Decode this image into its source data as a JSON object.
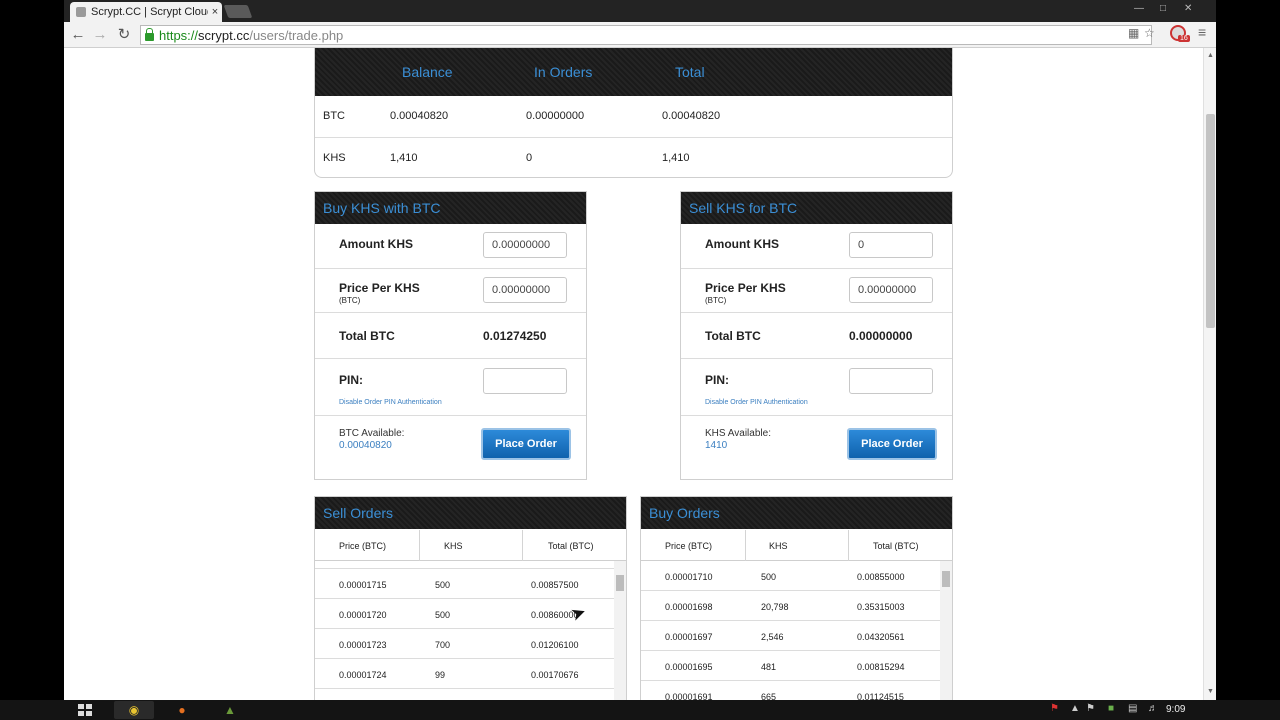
{
  "browser": {
    "tab_title": "Scrypt.CC | Scrypt Cloud M",
    "tab_close": "×",
    "url_scheme": "https://",
    "url_host": "scrypt.cc",
    "url_path": "/users/trade.php",
    "notification_count": "16"
  },
  "balances": {
    "headers": [
      "Balance",
      "In Orders",
      "Total"
    ],
    "rows": [
      {
        "currency": "BTC",
        "balance": "0.00040820",
        "in_orders": "0.00000000",
        "total": "0.00040820"
      },
      {
        "currency": "KHS",
        "balance": "1,410",
        "in_orders": "0",
        "total": "1,410"
      }
    ],
    "header_color": "#3b8fd6"
  },
  "buy_panel": {
    "title": "Buy KHS with BTC",
    "amount_label": "Amount KHS",
    "amount_placeholder": "0.00000000",
    "price_label": "Price Per KHS",
    "price_sub": "(BTC)",
    "price_placeholder": "0.00000000",
    "total_label": "Total BTC",
    "total_value": "0.01274250",
    "pin_label": "PIN:",
    "pin_link": "Disable Order PIN Authentication",
    "available_label": "BTC Available:",
    "available_value": "0.00040820",
    "button": "Place Order"
  },
  "sell_panel": {
    "title": "Sell KHS for BTC",
    "amount_label": "Amount KHS",
    "amount_value": "0",
    "price_label": "Price Per KHS",
    "price_sub": "(BTC)",
    "price_placeholder": "0.00000000",
    "total_label": "Total BTC",
    "total_value": "0.00000000",
    "pin_label": "PIN:",
    "pin_link": "Disable Order PIN Authentication",
    "available_label": "KHS Available:",
    "available_value": "1410",
    "button": "Place Order"
  },
  "sell_orders": {
    "title": "Sell Orders",
    "columns": [
      "Price (BTC)",
      "KHS",
      "Total (BTC)"
    ],
    "rows": [
      [
        "0.00001715",
        "500",
        "0.00857500"
      ],
      [
        "0.00001720",
        "500",
        "0.00860000"
      ],
      [
        "0.00001723",
        "700",
        "0.01206100"
      ],
      [
        "0.00001724",
        "99",
        "0.00170676"
      ]
    ]
  },
  "buy_orders": {
    "title": "Buy Orders",
    "columns": [
      "Price (BTC)",
      "KHS",
      "Total (BTC)"
    ],
    "rows": [
      [
        "0.00001710",
        "500",
        "0.00855000"
      ],
      [
        "0.00001698",
        "20,798",
        "0.35315003"
      ],
      [
        "0.00001697",
        "2,546",
        "0.04320561"
      ],
      [
        "0.00001695",
        "481",
        "0.00815294"
      ],
      [
        "0.00001691",
        "665",
        "0.01124515"
      ]
    ]
  },
  "taskbar": {
    "clock": "9:09"
  },
  "colors": {
    "accent_blue": "#3b8fd6",
    "button_blue": "#1976c8",
    "header_dark": "#1c1c1c"
  }
}
